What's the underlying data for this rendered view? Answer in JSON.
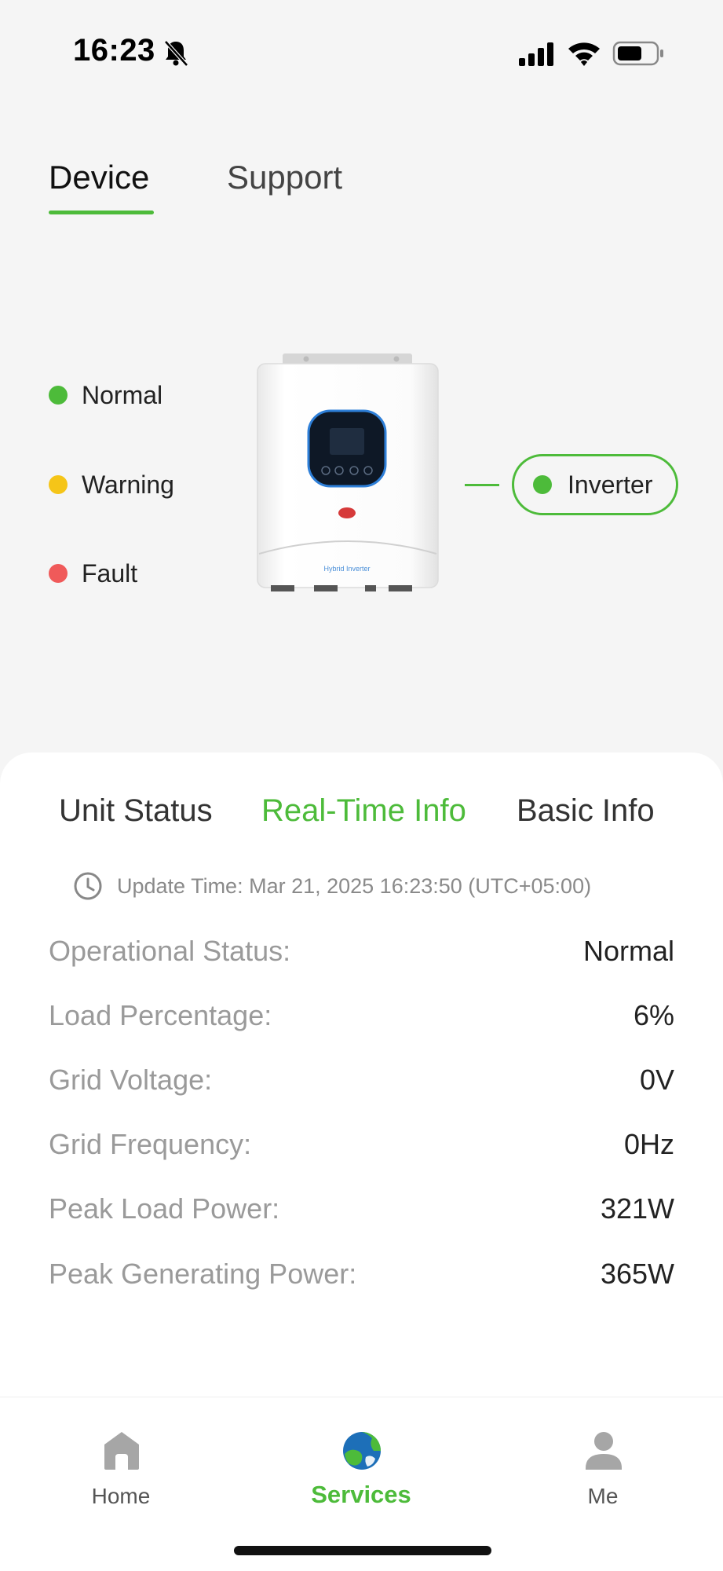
{
  "status_bar": {
    "time": "16:23",
    "icons": [
      "bell-slash-icon",
      "cellular-signal-icon",
      "wifi-icon",
      "battery-icon"
    ]
  },
  "top_tabs": [
    {
      "label": "Device",
      "active": true
    },
    {
      "label": "Support",
      "active": false
    }
  ],
  "legend": [
    {
      "label": "Normal",
      "color": "#4dbb3a"
    },
    {
      "label": "Warning",
      "color": "#f5c518"
    },
    {
      "label": "Fault",
      "color": "#f05a5a"
    }
  ],
  "device": {
    "image_text": "Hybrid Inverter",
    "pill_label": "Inverter",
    "status_color": "#4dbb3a"
  },
  "info_tabs": [
    {
      "label": "Unit Status",
      "active": false
    },
    {
      "label": "Real-Time Info",
      "active": true
    },
    {
      "label": "Basic Info",
      "active": false
    }
  ],
  "update_time": "Update Time: Mar 21, 2025 16:23:50 (UTC+05:00)",
  "info_rows": [
    {
      "label": "Operational Status:",
      "value": "Normal"
    },
    {
      "label": "Load Percentage:",
      "value": "6%"
    },
    {
      "label": "Grid Voltage:",
      "value": "0V"
    },
    {
      "label": "Grid Frequency:",
      "value": "0Hz"
    },
    {
      "label": "Peak Load Power:",
      "value": "321W"
    },
    {
      "label": "Peak Generating Power:",
      "value": "365W"
    }
  ],
  "bottom_nav": [
    {
      "label": "Home",
      "icon": "home-icon",
      "active": false
    },
    {
      "label": "Services",
      "icon": "globe-icon",
      "active": true
    },
    {
      "label": "Me",
      "icon": "user-icon",
      "active": false
    }
  ],
  "colors": {
    "accent": "#4dbb3a",
    "background": "#f5f5f5",
    "card": "#ffffff"
  }
}
